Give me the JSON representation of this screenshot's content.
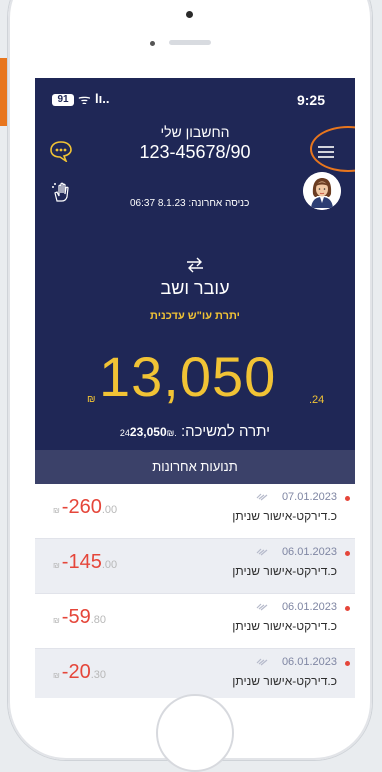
{
  "status_bar": {
    "battery": "91",
    "wifi": "ᯤ",
    "signal": "lı..",
    "time": "9:25"
  },
  "header": {
    "account_label": "החשבון שלי",
    "account_number": "123-45678/90",
    "last_login": "כניסה אחרונה: 8.1.23 06:37"
  },
  "account": {
    "type": "עובר ושב",
    "balance_label": "יתרת עו\"ש עדכנית",
    "balance_currency": "₪",
    "balance_main": "13,050",
    "balance_decimal": ".24",
    "withdraw_label": "יתרה למשיכה:",
    "withdraw_decimal": ".24",
    "withdraw_amount": "23,050",
    "withdraw_currency": "₪"
  },
  "transactions": {
    "title": "תנועות אחרונות",
    "rows": [
      {
        "currency": "₪",
        "amount": "-260",
        "decimal": ".00",
        "date": "07.01.2023",
        "description": "כ.דירקט-אישור שניתן"
      },
      {
        "currency": "₪",
        "amount": "-145",
        "decimal": ".00",
        "date": "06.01.2023",
        "description": "כ.דירקט-אישור שניתן"
      },
      {
        "currency": "₪",
        "amount": "-59",
        "decimal": ".80",
        "date": "06.01.2023",
        "description": "כ.דירקט-אישור שניתן"
      },
      {
        "currency": "₪",
        "amount": "-20",
        "decimal": ".30",
        "date": "06.01.2023",
        "description": "כ.דירקט-אישור שניתן"
      }
    ]
  },
  "colors": {
    "background": "#1f2756",
    "balance": "#f1c335",
    "negative": "#e5463a",
    "highlight": "#e8761e"
  },
  "icons": [
    "chat-icon",
    "accessibility-hand-icon",
    "menu-icon",
    "swap-icon",
    "link-icon",
    "avatar"
  ]
}
